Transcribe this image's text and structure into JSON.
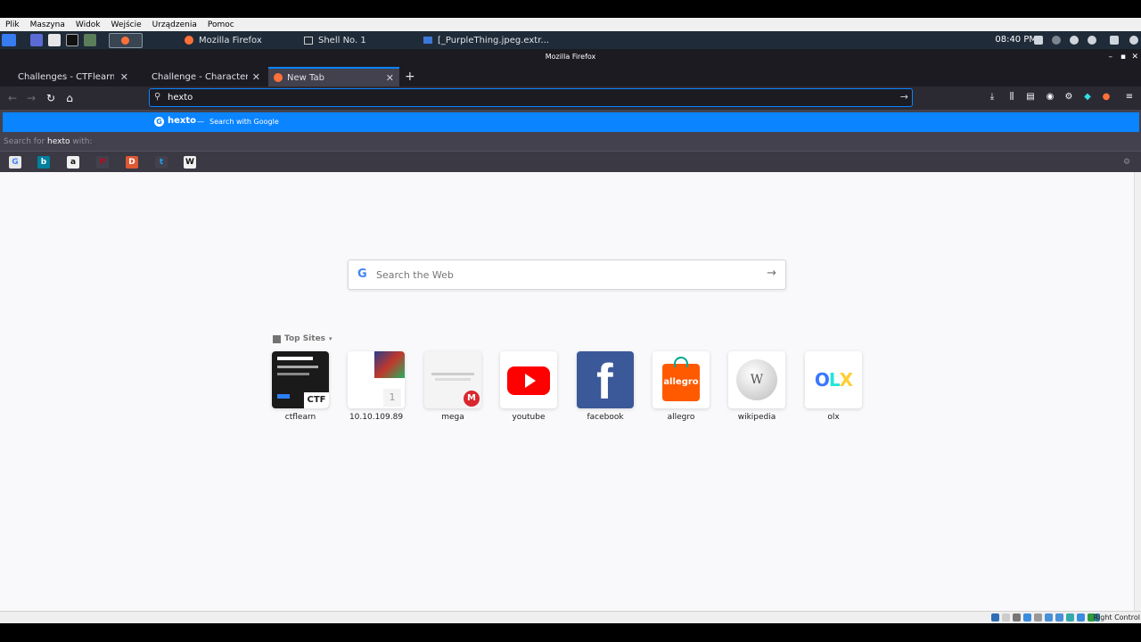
{
  "vbox_menu": [
    "Plik",
    "Maszyna",
    "Widok",
    "Wejście",
    "Urządzenia",
    "Pomoc"
  ],
  "panel": {
    "tasks": [
      "Mozilla Firefox",
      "Shell No. 1",
      "[_PurpleThing.jpeg.extr..."
    ],
    "clock": "08:40 PM"
  },
  "window_title": "Mozilla Firefox",
  "tabs": [
    {
      "label": "Challenges - CTFlearn -"
    },
    {
      "label": "Challenge - Character En"
    },
    {
      "label": "New Tab"
    }
  ],
  "urlbar": {
    "value": "hexto"
  },
  "dropdown": {
    "suggestion": "hexto",
    "separator": "—",
    "suggestion_action": "Search with Google",
    "hint_prefix": "Search for",
    "hint_term": "hexto",
    "hint_suffix": "with:"
  },
  "engines": [
    {
      "icon": "google-icon",
      "glyph": "G",
      "color": "#e8e8e8",
      "fg": "#4285f4"
    },
    {
      "icon": "bing-icon",
      "glyph": "b",
      "color": "#00809d",
      "fg": "#fff"
    },
    {
      "icon": "amazon-icon",
      "glyph": "a",
      "color": "#f0f0f0",
      "fg": "#111"
    },
    {
      "icon": "pinterest-icon",
      "glyph": "P",
      "color": "#42414d",
      "fg": "#bd081c"
    },
    {
      "icon": "duckduckgo-icon",
      "glyph": "D",
      "color": "#de5833",
      "fg": "#fff"
    },
    {
      "icon": "twitter-icon",
      "glyph": "t",
      "color": "#42414d",
      "fg": "#1da1f2"
    },
    {
      "icon": "wikipedia-icon",
      "glyph": "W",
      "color": "#f0f0f0",
      "fg": "#111"
    }
  ],
  "newtab": {
    "search_placeholder": "Search the Web",
    "top_sites_label": "Top Sites",
    "sites": [
      {
        "name": "ctflearn",
        "icon": "ctflearn-thumbnail",
        "tile_text": "CTF"
      },
      {
        "name": "10.10.109.89",
        "icon": "ip-thumbnail",
        "tile_text": "1"
      },
      {
        "name": "mega",
        "icon": "mega-thumbnail",
        "tile_text": "M"
      },
      {
        "name": "youtube",
        "icon": "youtube-icon",
        "tile_text": ""
      },
      {
        "name": "facebook",
        "icon": "facebook-icon",
        "tile_text": "f"
      },
      {
        "name": "allegro",
        "icon": "allegro-icon",
        "tile_text": "allegro"
      },
      {
        "name": "wikipedia",
        "icon": "wikipedia-globe-icon",
        "tile_text": "W"
      },
      {
        "name": "olx",
        "icon": "olx-icon",
        "tile_text": "OLX"
      }
    ]
  },
  "statusbar": {
    "right_control": "Right Control"
  },
  "colors": {
    "accent": "#0a84ff",
    "toolbar": "#2b2a33",
    "tabstrip": "#1c1b22",
    "panel": "#1f2b38"
  }
}
